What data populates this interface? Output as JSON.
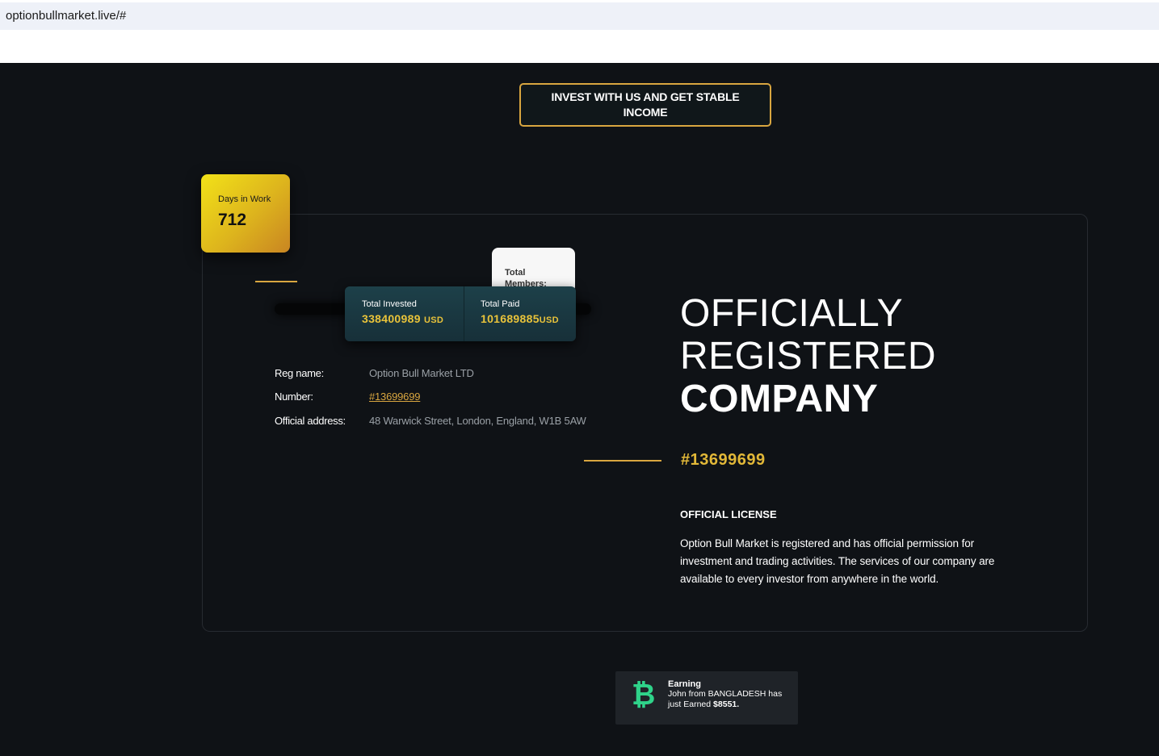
{
  "browser": {
    "url": "optionbullmarket.live/#"
  },
  "cta": {
    "label_line1": "INVEST WITH US AND GET STABLE",
    "label_line2": "INCOME"
  },
  "days_card": {
    "label": "Days in Work",
    "value": "712"
  },
  "members_card": {
    "label": "Total Members:"
  },
  "stats": {
    "invested": {
      "label": "Total Invested",
      "value": "338400989",
      "unit": "USD"
    },
    "paid": {
      "label": "Total Paid",
      "value": "101689885",
      "unit": "USD"
    }
  },
  "company_info": {
    "reg_name_label": "Reg name:",
    "reg_name_value": "Option Bull Market LTD",
    "number_label": "Number:",
    "number_value": "#13699699",
    "address_label": "Official address:",
    "address_value": "48 Warwick Street, London, England, W1B 5AW"
  },
  "heading": {
    "line1": "OFFICIALLY",
    "line2": "REGISTERED",
    "line3": "COMPANY"
  },
  "reg_number": "#13699699",
  "license": {
    "title": "OFFICIAL LICENSE",
    "text": "Option Bull Market is registered and has official permission for investment and trading activities. The services of our company are available to every investor from anywhere in the world."
  },
  "toast": {
    "icon": "bitcoin-icon",
    "title": "Earning",
    "message_prefix": "John from BANGLADESH has just Earned",
    "amount": "$8551."
  },
  "colors": {
    "accent_gold": "#d9a640",
    "background": "#0f1216",
    "bitcoin_green": "#2fd38a"
  }
}
